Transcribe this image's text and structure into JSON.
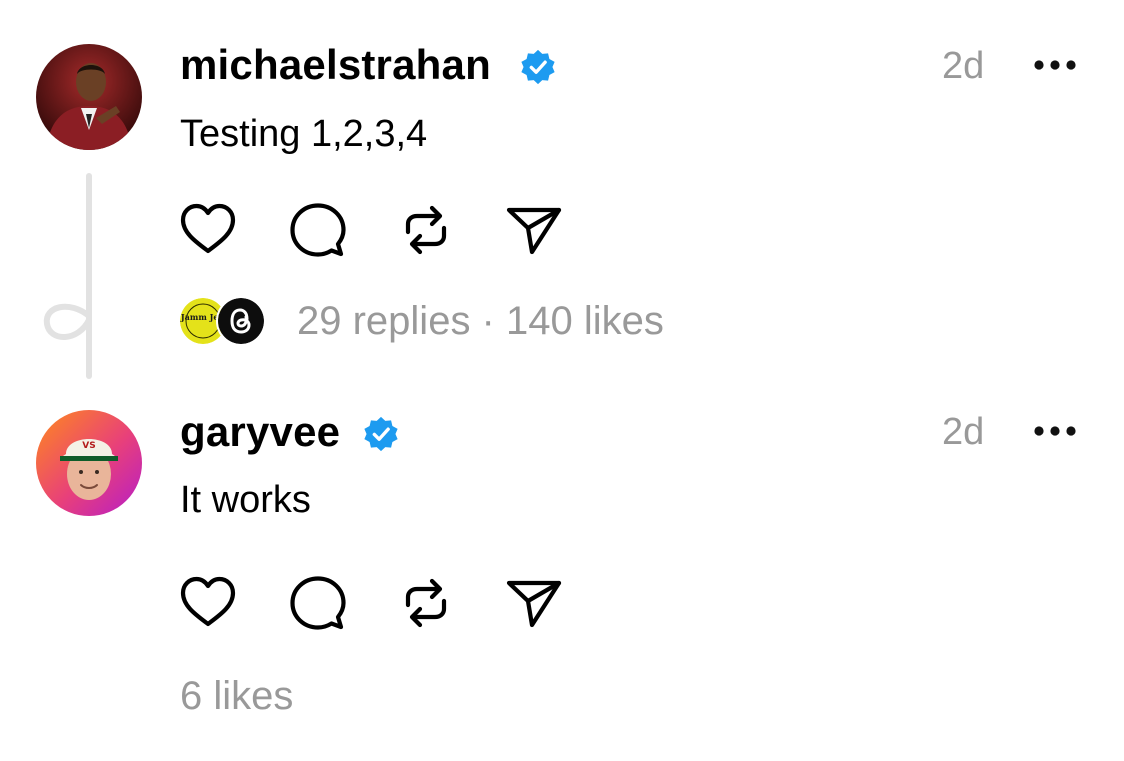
{
  "posts": [
    {
      "username": "michaelstrahan",
      "timestamp": "2d",
      "text": "Testing 1,2,3,4",
      "stats": "29 replies · 140 likes",
      "reply_avatar_text": "Jamm JeR"
    },
    {
      "username": "garyvee",
      "timestamp": "2d",
      "text": "It works",
      "stats": "6 likes",
      "avatar_cap_text": "VS"
    }
  ],
  "icons": {
    "verified": "verified-badge-icon",
    "more": "more-options-icon",
    "like": "heart-icon",
    "reply": "comment-icon",
    "repost": "repost-icon",
    "share": "send-icon"
  },
  "colors": {
    "verified": "#1D9BF0",
    "muted_text": "#999999",
    "thread_line": "#E2E2E2"
  }
}
